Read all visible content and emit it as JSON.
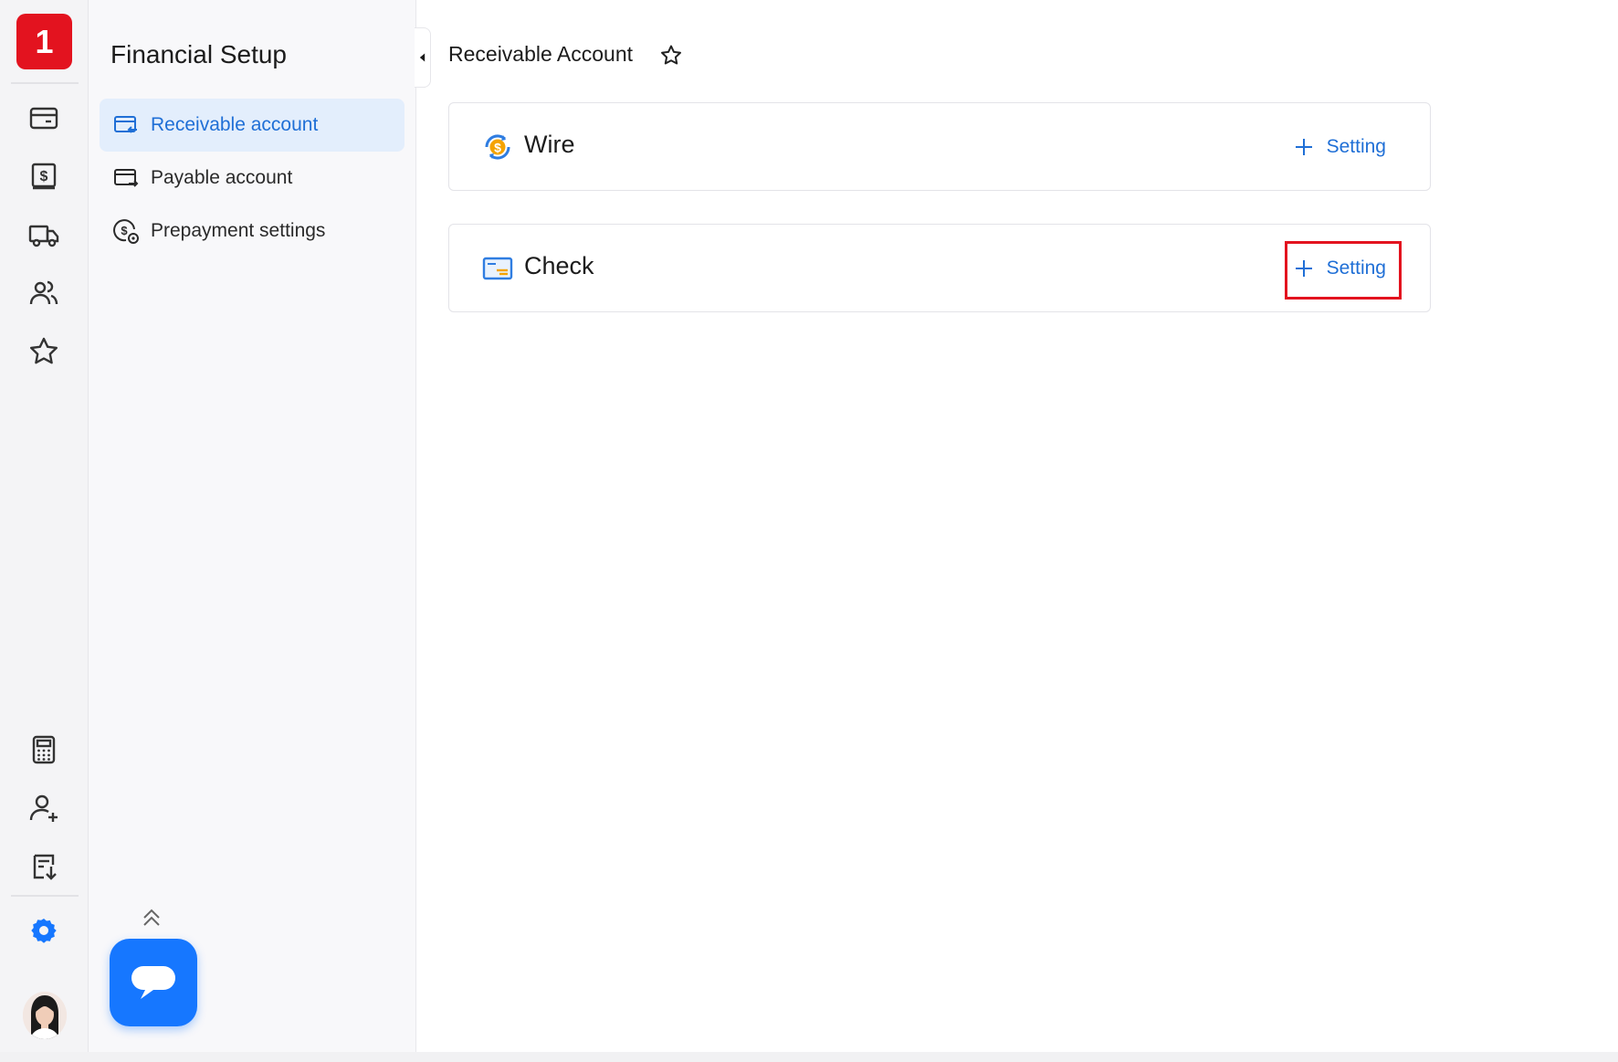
{
  "rail": {
    "logo_text": "1",
    "top_icons": [
      "card-icon",
      "dollar-box-icon",
      "truck-icon",
      "users-icon",
      "star-icon"
    ],
    "bottom_icons": [
      "calculator-icon",
      "add-user-icon",
      "download-list-icon"
    ],
    "settings_icon": "gear-icon",
    "accent": "#1677ff",
    "brand_color": "#e3131f"
  },
  "sidebar": {
    "title": "Financial Setup",
    "items": [
      {
        "label": "Receivable account",
        "icon": "receivable-card-icon",
        "active": true
      },
      {
        "label": "Payable account",
        "icon": "payable-card-icon",
        "active": false
      },
      {
        "label": "Prepayment settings",
        "icon": "dollar-gear-icon",
        "active": false
      }
    ]
  },
  "main": {
    "title": "Receivable Account",
    "methods": [
      {
        "name": "Wire",
        "icon": "wire-dollar-icon",
        "action_label": "Setting"
      },
      {
        "name": "Check",
        "icon": "check-cheque-icon",
        "action_label": "Setting"
      }
    ]
  },
  "colors": {
    "link": "#1f6fd6",
    "active_bg": "#e3eefc",
    "highlight": "#e3131f"
  }
}
